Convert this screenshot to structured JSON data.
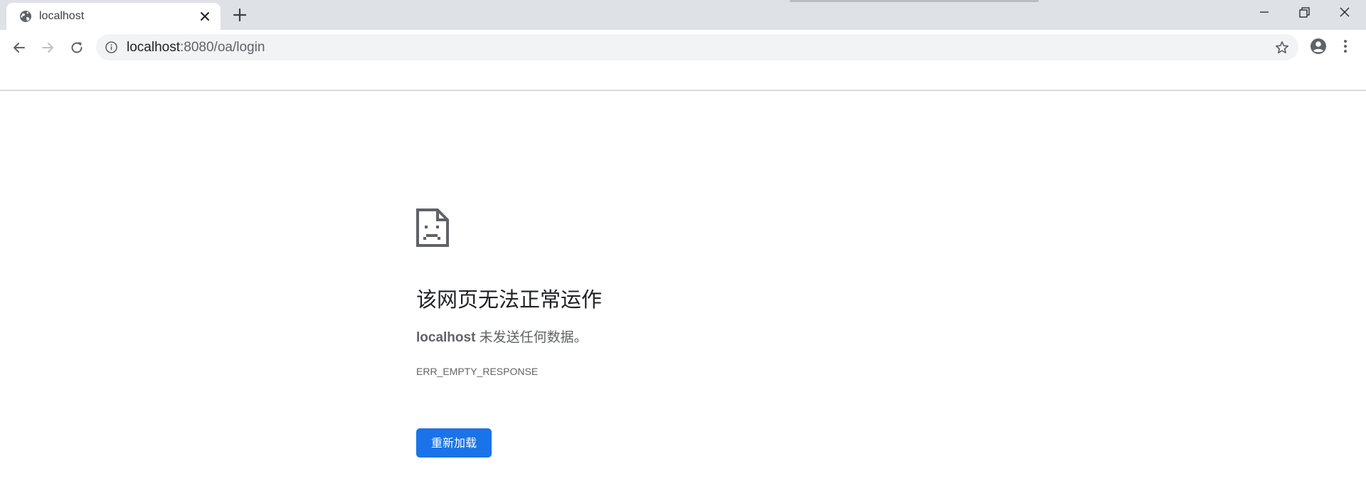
{
  "tab": {
    "title": "localhost",
    "favicon_icon": "globe-icon",
    "close_icon": "close-icon"
  },
  "new_tab_icon": "plus-icon",
  "window_controls": {
    "minimize_icon": "minimize-icon",
    "restore_icon": "restore-icon",
    "close_icon": "close-icon"
  },
  "toolbar": {
    "back_icon": "arrow-left-icon",
    "forward_icon": "arrow-right-icon",
    "reload_icon": "reload-icon",
    "profile_icon": "account-circle-icon",
    "menu_icon": "more-vertical-icon"
  },
  "omnibox": {
    "info_icon": "info-icon",
    "host": "localhost",
    "path": ":8080/oa/login",
    "bookmark_icon": "star-outline-icon"
  },
  "error_page": {
    "icon": "sad-document-icon",
    "heading": "该网页无法正常运作",
    "desc_host": "localhost",
    "desc_text": " 未发送任何数据。",
    "error_code": "ERR_EMPTY_RESPONSE",
    "reload_button": "重新加载"
  },
  "colors": {
    "tabstrip_bg": "#dee1e6",
    "omnibox_bg": "#f1f3f4",
    "accent_button": "#1a73e8",
    "text_primary": "#202124",
    "text_secondary": "#5f6368"
  }
}
